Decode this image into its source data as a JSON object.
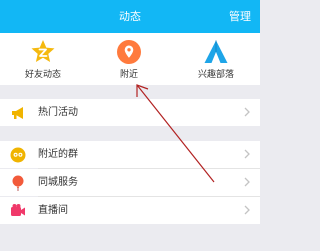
{
  "header": {
    "title": "动态",
    "manage_label": "管理"
  },
  "quick_entries": [
    {
      "label": "好友动态",
      "icon": "star-icon",
      "color": "#f5b90f"
    },
    {
      "label": "附近",
      "icon": "location-pin-icon",
      "color": "#ff7a3d"
    },
    {
      "label": "兴趣部落",
      "icon": "tent-icon",
      "color": "#1ea5e8"
    }
  ],
  "sections": [
    {
      "label": "热门活动",
      "icon": "megaphone-icon",
      "color": "#f0b400"
    },
    {
      "label": "附近的群",
      "icon": "group-icon",
      "color": "#f0b400"
    },
    {
      "label": "同城服务",
      "icon": "balloon-icon",
      "color": "#f25a3a"
    },
    {
      "label": "直播间",
      "icon": "video-camera-icon",
      "color": "#f0396a"
    }
  ]
}
